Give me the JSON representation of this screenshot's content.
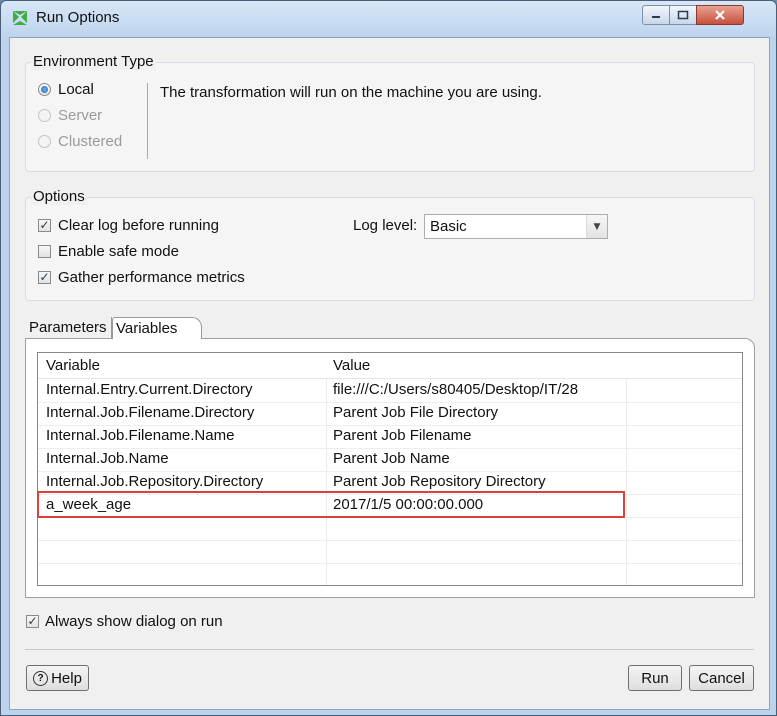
{
  "window": {
    "title": "Run Options"
  },
  "environment": {
    "group_label": "Environment Type",
    "options": [
      {
        "label": "Local",
        "selected": true,
        "enabled": true
      },
      {
        "label": "Server",
        "selected": false,
        "enabled": false
      },
      {
        "label": "Clustered",
        "selected": false,
        "enabled": false
      }
    ],
    "description": "The transformation will run on the machine you are using."
  },
  "options": {
    "group_label": "Options",
    "clear_log": {
      "label": "Clear log before running",
      "checked": true
    },
    "safe_mode": {
      "label": "Enable safe mode",
      "checked": false
    },
    "gather_metrics": {
      "label": "Gather performance metrics",
      "checked": true
    },
    "log_level_label": "Log level:",
    "log_level_value": "Basic"
  },
  "tabs": {
    "parameters": "Parameters",
    "variables": "Variables"
  },
  "variables_table": {
    "headers": {
      "variable": "Variable",
      "value": "Value"
    },
    "rows": [
      {
        "variable": "Internal.Entry.Current.Directory",
        "value": "file:///C:/Users/s80405/Desktop/IT/28"
      },
      {
        "variable": "Internal.Job.Filename.Directory",
        "value": "Parent Job File Directory"
      },
      {
        "variable": "Internal.Job.Filename.Name",
        "value": "Parent Job Filename"
      },
      {
        "variable": "Internal.Job.Name",
        "value": "Parent Job Name"
      },
      {
        "variable": "Internal.Job.Repository.Directory",
        "value": "Parent Job Repository Directory"
      },
      {
        "variable": "a_week_age",
        "value": "2017/1/5 00:00:00.000"
      }
    ]
  },
  "always_show": {
    "label": "Always show dialog on run",
    "checked": true
  },
  "buttons": {
    "help": "Help",
    "run": "Run",
    "cancel": "Cancel"
  },
  "colors": {
    "highlight": "#d9413c",
    "accent": "#1d5fb4"
  },
  "icons": {
    "app": "pentaho-spoon-icon",
    "help": "help-icon"
  }
}
